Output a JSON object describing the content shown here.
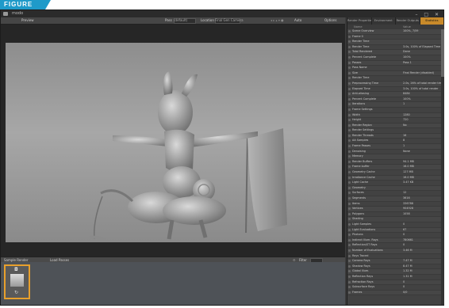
{
  "figure": {
    "label": "FIGURE 1.90"
  },
  "window": {
    "title": "modo",
    "controls": "– □ ✕"
  },
  "toolbar": {
    "preview": "Preview",
    "pass": "Pass",
    "pass_val": "(default)",
    "location": "Location",
    "location_val": "Final Gen Camera",
    "right_a": "Auto",
    "right_b": "Options"
  },
  "timeline": {
    "left": "Sample Render",
    "mid": "Load Passes",
    "filter": "Filter"
  },
  "tabs": [
    "Render Properties",
    "Environment",
    "Render Outputs",
    "Statistics"
  ],
  "panel_head": {
    "name": "Name",
    "value": "Value"
  },
  "stats": [
    {
      "k": "Scene Overview",
      "v": "100%, 7/59"
    },
    {
      "k": "Frame 0",
      "v": ""
    },
    {
      "k": "Render Time",
      "v": ""
    },
    {
      "k": "Render Time",
      "v": "3.0s, 100% of Elapsed Time"
    },
    {
      "k": "Total Rendered",
      "v": "Done"
    },
    {
      "k": "Percent Complete",
      "v": "100%"
    },
    {
      "k": "Passes",
      "v": "Pass 1"
    },
    {
      "k": "Pass Name",
      "v": ""
    },
    {
      "k": "Size",
      "v": "Final Render (disabled)"
    },
    {
      "k": "Render Time",
      "v": ""
    },
    {
      "k": "Preprocessing Time",
      "v": "2.0s, 26% of total render time"
    },
    {
      "k": "Elapsed Time",
      "v": "3.0s, 100% of total render"
    },
    {
      "k": "Anti-aliasing",
      "v": "8484"
    },
    {
      "k": "Percent Complete",
      "v": "100%"
    },
    {
      "k": "Iterations",
      "v": "1"
    },
    {
      "k": "Frame Settings",
      "v": ""
    },
    {
      "k": "Width",
      "v": "1280"
    },
    {
      "k": "Height",
      "v": "720"
    },
    {
      "k": "Render Region",
      "v": "No"
    },
    {
      "k": "Render Settings",
      "v": ""
    },
    {
      "k": "Render Threads",
      "v": "16"
    },
    {
      "k": "AA Samples",
      "v": "8"
    },
    {
      "k": "Frame Passes",
      "v": "1"
    },
    {
      "k": "Denoising",
      "v": "None"
    },
    {
      "k": "Memory",
      "v": ""
    },
    {
      "k": "Render Buffers",
      "v": "94.1 MB"
    },
    {
      "k": "Frame buffer",
      "v": "16.0 MB"
    },
    {
      "k": "Geometry Cache",
      "v": "127 MB"
    },
    {
      "k": "Irradiance Cache",
      "v": "16.0 MB"
    },
    {
      "k": "Light Cache",
      "v": "3.47 KB"
    },
    {
      "k": "Geometry",
      "v": ""
    },
    {
      "k": "Surfaces",
      "v": "12"
    },
    {
      "k": "Segments",
      "v": "3616"
    },
    {
      "k": "Items",
      "v": "336788"
    },
    {
      "k": "Vertices",
      "v": "904928"
    },
    {
      "k": "Polygons",
      "v": "1058"
    },
    {
      "k": "Shading",
      "v": ""
    },
    {
      "k": "Light Samples",
      "v": "0"
    },
    {
      "k": "Light Evaluations",
      "v": "67"
    },
    {
      "k": "Photons",
      "v": "0"
    },
    {
      "k": "Indirect Illum. Rays",
      "v": "780661"
    },
    {
      "k": "Reflection/ST Rays",
      "v": "0"
    },
    {
      "k": "Number of Evaluations",
      "v": "3.46 M"
    },
    {
      "k": "Rays Traced",
      "v": ""
    },
    {
      "k": "Camera Rays",
      "v": "7.47 M"
    },
    {
      "k": "Shadow Rays",
      "v": "8.47 M"
    },
    {
      "k": "Global Illum.",
      "v": "1.32 M"
    },
    {
      "k": "Reflection Rays",
      "v": "1.31 M"
    },
    {
      "k": "Refraction Rays",
      "v": "0"
    },
    {
      "k": "Subsurface Rays",
      "v": "0"
    },
    {
      "k": "Frames",
      "v": "0/0"
    }
  ]
}
